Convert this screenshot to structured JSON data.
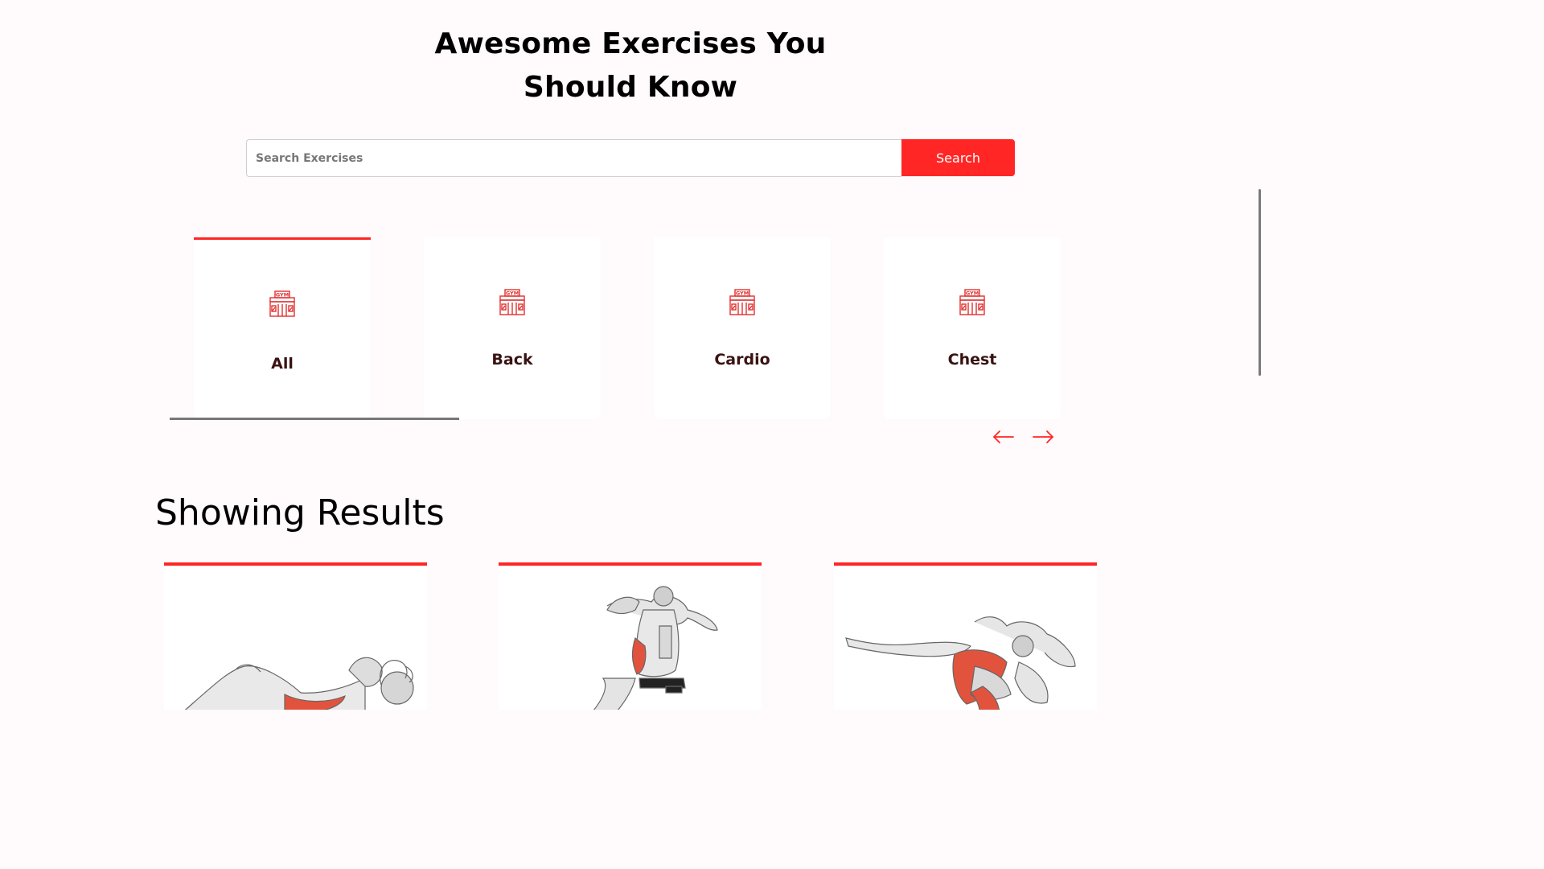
{
  "hero": {
    "title_line1": "Awesome Exercises You",
    "title_line2": "Should Know"
  },
  "search": {
    "placeholder": "Search Exercises",
    "value": "",
    "button_label": "Search"
  },
  "categories": [
    {
      "label": "All",
      "icon": "gym-icon",
      "active": true
    },
    {
      "label": "Back",
      "icon": "gym-icon",
      "active": false
    },
    {
      "label": "Cardio",
      "icon": "gym-icon",
      "active": false
    },
    {
      "label": "Chest",
      "icon": "gym-icon",
      "active": false
    }
  ],
  "carousel": {
    "prev_icon": "left-arrow-icon",
    "next_icon": "right-arrow-icon"
  },
  "results": {
    "title": "Showing Results",
    "cards": [
      {
        "image": "crunch-exercise-illustration"
      },
      {
        "image": "decline-sit-up-exercise-illustration"
      },
      {
        "image": "bicycle-crunch-exercise-illustration"
      }
    ]
  },
  "colors": {
    "accent": "#ff2625",
    "background": "#fffafb",
    "category_text": "#3a1212"
  }
}
